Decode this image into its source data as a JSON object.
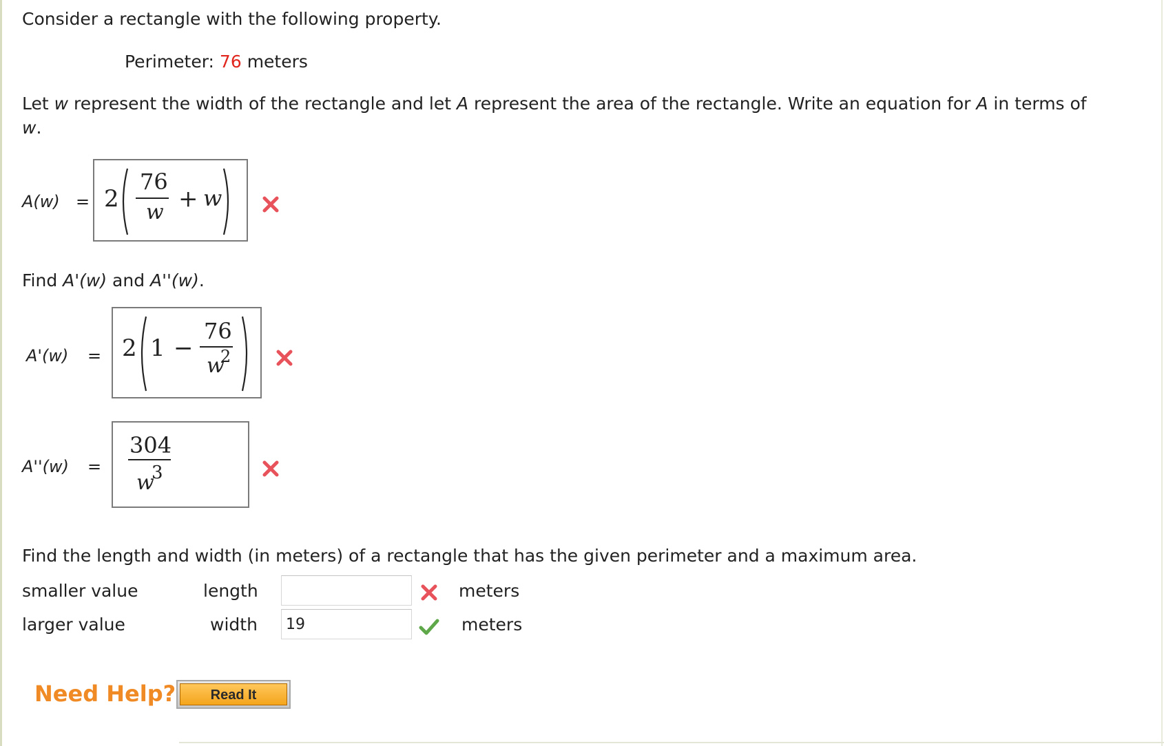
{
  "problem": {
    "intro": "Consider a rectangle with the following property.",
    "perimeter_label": "Perimeter:",
    "perimeter_value": "76",
    "perimeter_unit": "meters",
    "instruction_part1": "Let ",
    "instruction_w": "w",
    "instruction_part2": " represent the width of the rectangle and let ",
    "instruction_A": "A",
    "instruction_part3": " represent the area of the rectangle. Write an equation for ",
    "instruction_A2": "A",
    "instruction_part4": " in terms of",
    "instruction_w2": "w",
    "instruction_end": "."
  },
  "area_equation": {
    "label": "A(w)",
    "equals": "=",
    "coef": "2",
    "numerator": "76",
    "denominator": "w",
    "plus": "+",
    "term": "w",
    "status": "incorrect"
  },
  "derivatives": {
    "prompt_part1": "Find ",
    "prompt_first": "A'(w)",
    "prompt_and": " and ",
    "prompt_second": "A''(w)",
    "prompt_end": ".",
    "first": {
      "label": "A'(w)",
      "equals": "=",
      "coef": "2",
      "one": "1",
      "minus": "−",
      "numerator": "76",
      "denominator_base": "w",
      "denominator_exp": "2",
      "status": "incorrect"
    },
    "second": {
      "label": "A''(w)",
      "equals": "=",
      "numerator": "304",
      "denominator_base": "w",
      "denominator_exp": "3",
      "status": "incorrect"
    }
  },
  "max_area": {
    "prompt": "Find the length and width (in meters) of a rectangle that has the given perimeter and a maximum area.",
    "rows": [
      {
        "value_label": "smaller value",
        "dim_label": "length",
        "input_value": "",
        "unit": "meters",
        "status": "incorrect"
      },
      {
        "value_label": "larger value",
        "dim_label": "width",
        "input_value": "19",
        "unit": "meters",
        "status": "correct"
      }
    ]
  },
  "help": {
    "need_help": "Need Help?",
    "read_it": "Read It"
  },
  "colors": {
    "highlight_red": "#e0261d",
    "incorrect_mark": "#e8525a",
    "correct_mark": "#5fa84a",
    "need_help_orange": "#f08a24",
    "button_orange": "#f4a51c"
  },
  "icons": {
    "incorrect": "x-mark-icon",
    "correct": "check-mark-icon"
  }
}
